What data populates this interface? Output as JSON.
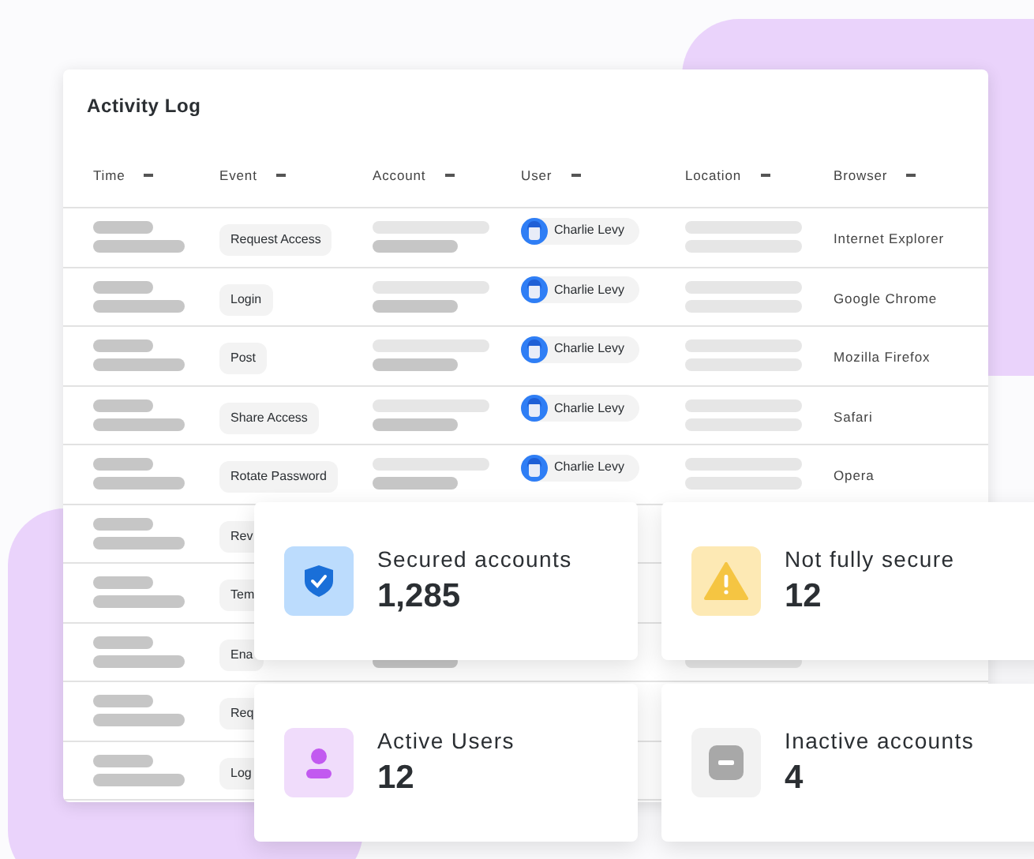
{
  "title": "Activity Log",
  "columns": [
    "Time",
    "Event",
    "Account",
    "User",
    "Location",
    "Browser"
  ],
  "rows": [
    {
      "event": "Request Access",
      "user": "Charlie Levy",
      "browser": "Internet Explorer"
    },
    {
      "event": "Login",
      "user": "Charlie Levy",
      "browser": "Google Chrome"
    },
    {
      "event": "Post",
      "user": "Charlie Levy",
      "browser": "Mozilla Firefox"
    },
    {
      "event": "Share Access",
      "user": "Charlie Levy",
      "browser": "Safari"
    },
    {
      "event": "Rotate Password",
      "user": "Charlie Levy",
      "browser": "Opera"
    },
    {
      "event": "Rev"
    },
    {
      "event": "Tem"
    },
    {
      "event": "Ena"
    },
    {
      "event": "Req"
    },
    {
      "event": "Log"
    }
  ],
  "stats": [
    {
      "kind": "shield",
      "label": "Secured accounts",
      "value": "1,285"
    },
    {
      "kind": "warning",
      "label": "Not fully secure",
      "value": "12"
    },
    {
      "kind": "user",
      "label": "Active Users",
      "value": "12"
    },
    {
      "kind": "inactive",
      "label": "Inactive accounts",
      "value": "4"
    }
  ]
}
